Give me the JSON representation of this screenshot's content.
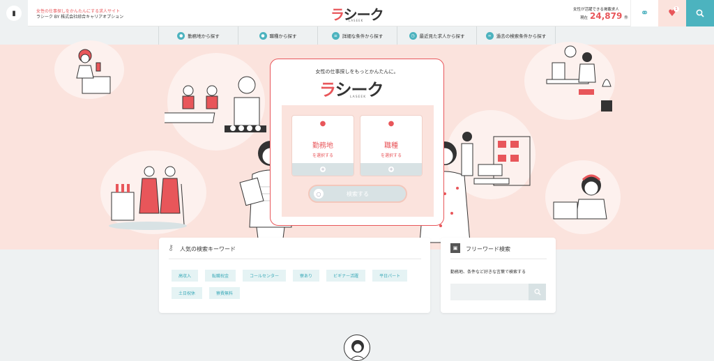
{
  "header": {
    "tagline": "女性の仕事探しをかんたんにする求人サイト",
    "company": "ラシーク BY 株式会社綜合キャリアオプション",
    "brand_ra": "ラ",
    "brand_rest": "シーク",
    "brand_sub": "LASEEK",
    "count_label": "女性が活躍できる掲載求人",
    "count_prefix": "現在",
    "count_value": "24,879",
    "count_suffix": "件",
    "fav_badge": "1"
  },
  "nav": {
    "items": [
      {
        "label": "勤務地から探す",
        "icon": "pin-icon"
      },
      {
        "label": "職種から探す",
        "icon": "person-icon"
      },
      {
        "label": "詳細な条件から探す",
        "icon": "list-icon"
      },
      {
        "label": "最近見た求人から探す",
        "icon": "clock-icon"
      },
      {
        "label": "過去の検索条件から探す",
        "icon": "link-icon"
      }
    ]
  },
  "search_card": {
    "tagline": "女性の仕事探しをもっとかんたんに。",
    "brand_ra": "ラ",
    "brand_rest": "シーク",
    "brand_sub": "LASEEK",
    "location": {
      "label": "勤務地",
      "sub": "を選択する"
    },
    "job": {
      "label": "職種",
      "sub": "を選択する"
    },
    "search_button": "検索する"
  },
  "keywords": {
    "title": "人気の検索キーワード",
    "tags": [
      "高収入",
      "転職祝金",
      "コールセンター",
      "寮あり",
      "ビギナー活躍",
      "平日パート",
      "土日祝休",
      "寮費無料"
    ]
  },
  "freeword": {
    "title": "フリーワード検索",
    "description": "勤務地、条件など好きな言葉で検索する",
    "placeholder": ""
  }
}
